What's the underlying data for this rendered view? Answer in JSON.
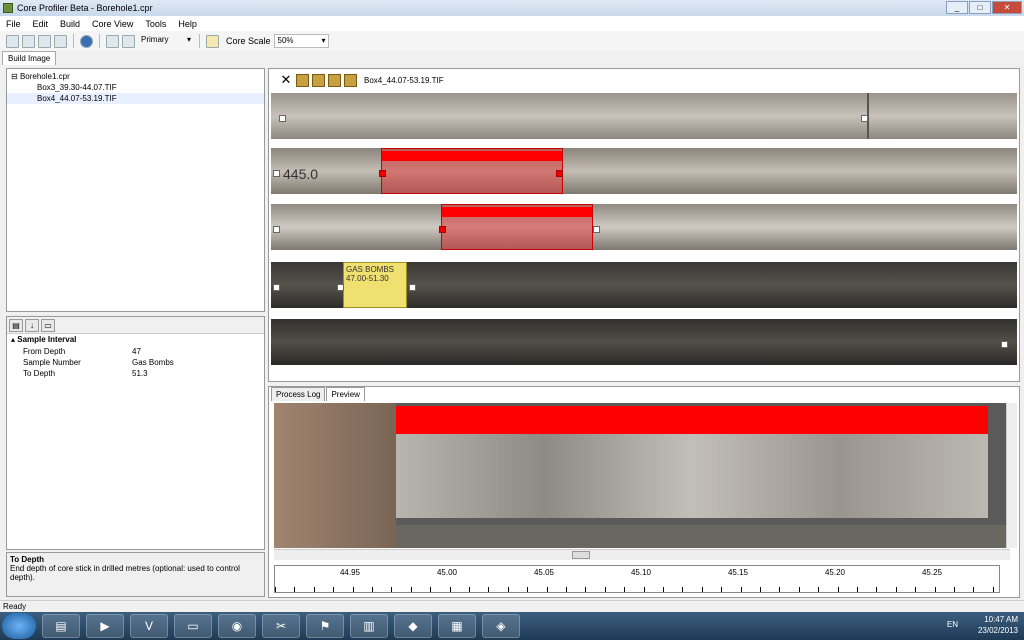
{
  "window": {
    "title": "Core Profiler Beta - Borehole1.cpr",
    "btn_min": "_",
    "btn_max": "□",
    "btn_close": "✕"
  },
  "menu": [
    "File",
    "Edit",
    "Build",
    "Core View",
    "Tools",
    "Help"
  ],
  "toolbar": {
    "mode": "Primary",
    "core_scale_label": "Core Scale",
    "core_scale_value": "50%"
  },
  "tabs": {
    "build_image": "Build Image"
  },
  "tree": {
    "root": "Borehole1.cpr",
    "items": [
      "Box3_39.30-44.07.TIF",
      "Box4_44.07-53.19.TIF"
    ]
  },
  "properties": {
    "category": "Sample Interval",
    "rows": [
      {
        "key": "From Depth",
        "value": "47"
      },
      {
        "key": "Sample Number",
        "value": "Gas Bombs"
      },
      {
        "key": "To Depth",
        "value": "51.3"
      }
    ]
  },
  "description": {
    "title": "To Depth",
    "text": "End depth of core stick in drilled metres (optional: used to control depth)."
  },
  "viewer": {
    "filename": "Box4_44.07-53.19.TIF",
    "label_text": "GAS BOMBS 47.00-51.30",
    "core_mark": "445.0"
  },
  "lower_tabs": [
    "Process Log",
    "Preview"
  ],
  "ruler": {
    "labels": [
      "44.95",
      "45.00",
      "45.05",
      "45.10",
      "45.15",
      "45.20",
      "45.25"
    ]
  },
  "status": "Ready",
  "tray": {
    "lang": "EN",
    "time": "10:47 AM",
    "date": "23/02/2013"
  }
}
